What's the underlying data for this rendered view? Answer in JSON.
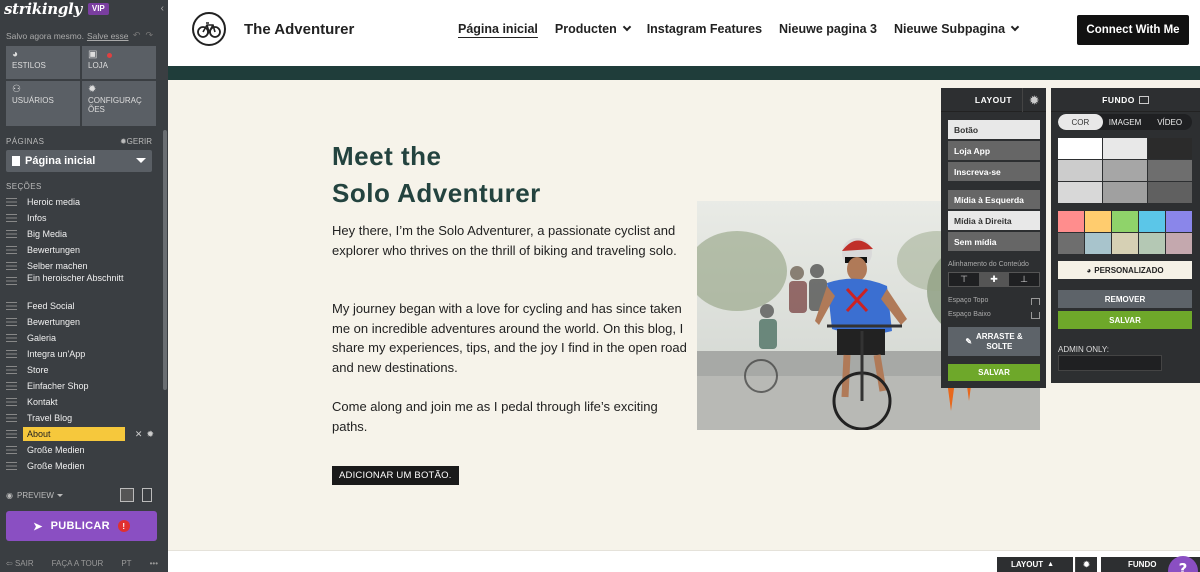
{
  "sidebar": {
    "logo": "strikingly",
    "vip": "VIP",
    "saved_text": "Salvo agora mesmo.",
    "save_version": "Salve esse",
    "tiles": [
      {
        "label": "ESTILOS",
        "icon": "palette-icon"
      },
      {
        "label": "LOJA",
        "icon": "shop-bag-icon"
      },
      {
        "label": "USUÁRIOS",
        "icon": "users-icon"
      },
      {
        "label": "CONFIGURAÇÕES",
        "label_line1": "CONFIGURAÇ",
        "label_line2": "ÕES",
        "icon": "gear-icon"
      }
    ],
    "pages_label": "PÁGINAS",
    "manage_label": "GERIR",
    "current_page": "Página inicial",
    "sections_label": "SEÇÕES",
    "sections": [
      "Heroic media",
      "Infos",
      "Big Media",
      "Bewertungen",
      "Selber machen",
      "Ein heroischer Abschnitt",
      "Feed Social",
      "Bewertungen",
      "Galeria",
      "Integra un'App",
      "Store",
      "Einfacher Shop",
      "Kontakt",
      "Travel Blog",
      "About",
      "Große Medien",
      "Große Medien"
    ],
    "active_section": "About",
    "preview": "PREVIEW",
    "publish": "PUBLICAR",
    "exit": "SAIR",
    "tour": "FAÇA A TOUR",
    "lang": "PT"
  },
  "site": {
    "brand": "The Adventurer",
    "nav": [
      "Página inicial",
      "Producten",
      "Instagram Features",
      "Nieuwe pagina 3",
      "Nieuwe Subpagina"
    ],
    "cta": "Connect With Me",
    "title_line1": "Meet the",
    "title_line2": "Solo Adventurer",
    "paragraphs": [
      "Hey there, I’m the Solo Adventurer, a passionate cyclist and explorer who thrives on the thrill of biking and traveling solo.",
      "My journey began with a love for cycling and has since taken me on incredible adventures around the world. On this blog, I share my experiences, tips, and the joy I find in the open road and new destinations.",
      "Come along and join me as I pedal through life’s exciting paths."
    ],
    "add_button": "ADICIONAR UM BOTÃO."
  },
  "layout_panel": {
    "title": "LAYOUT",
    "buttons_group1": [
      "Botão",
      "Loja App",
      "Inscreva-se"
    ],
    "buttons_group2": [
      "Mídia à Esquerda",
      "Mídia à Direita",
      "Sem mídia"
    ],
    "align_label": "Alinhamento do Conteúdo",
    "space_top": "Espaço Topo",
    "space_bottom": "Espaço Baixo",
    "drag_line1": "ARRASTE &",
    "drag_line2": "SOLTE",
    "save": "SALVAR"
  },
  "fundo_panel": {
    "title": "FUNDO",
    "tabs": [
      "COR",
      "IMAGEM",
      "VÍDEO"
    ],
    "swatches": [
      "#ffffff",
      "#e8e8e8",
      "#2b2b2b",
      "#2b2b2b",
      "#cccccc",
      "#a6a6a6",
      "#6e6e6e",
      "#3a3a3a",
      "#d8d8d8",
      "#a0a0a0",
      "#606060",
      "#383838",
      "#ff8d8d",
      "#ffcc6e",
      "#8fd36a",
      "#5bc6e8",
      "#8a86ea",
      "#6e6e6e",
      "#a8c4cc",
      "#d6d0b4",
      "#b4c8b4",
      "#c4a8ae"
    ],
    "personalize": "PERSONALIZADO",
    "remove": "REMOVER",
    "save": "SALVAR",
    "admin_only": "ADMIN ONLY:"
  },
  "bottom_tabs": {
    "layout": "LAYOUT",
    "fundo": "FUNDO",
    "help": "?"
  }
}
